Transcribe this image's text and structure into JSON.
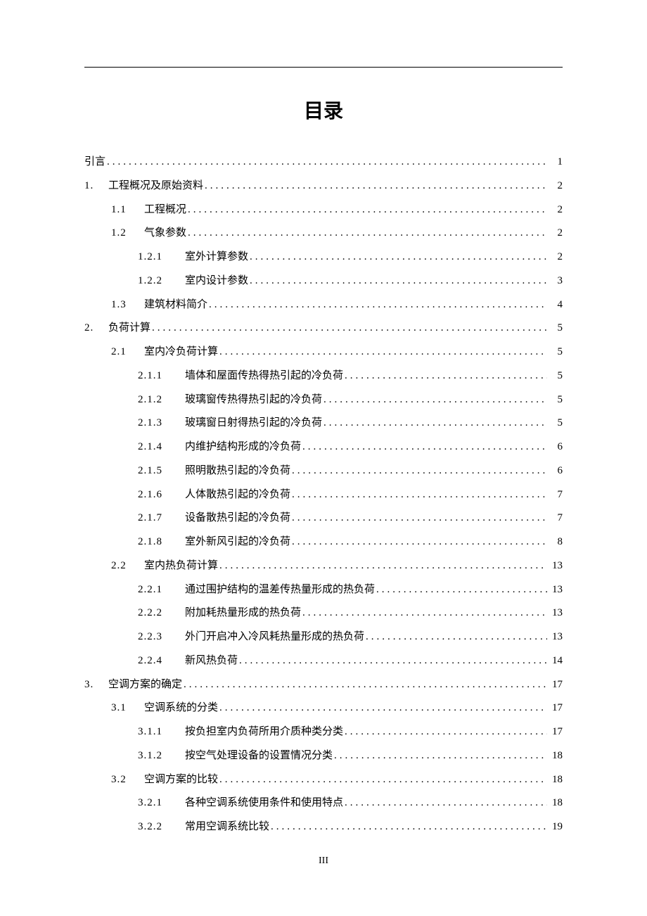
{
  "title": "目录",
  "page_number": "III",
  "toc": [
    {
      "level": 0,
      "num": "",
      "label": "引言",
      "page": "1"
    },
    {
      "level": 0,
      "num": "1.",
      "label": "工程概况及原始资料",
      "page": "2"
    },
    {
      "level": 1,
      "num": "1.1",
      "label": "工程概况",
      "page": "2"
    },
    {
      "level": 1,
      "num": "1.2",
      "label": "气象参数",
      "page": "2"
    },
    {
      "level": 2,
      "num": "1.2.1",
      "label": "室外计算参数",
      "page": "2"
    },
    {
      "level": 2,
      "num": "1.2.2",
      "label": "室内设计参数",
      "page": "3"
    },
    {
      "level": 1,
      "num": "1.3",
      "label": "建筑材料简介",
      "page": "4"
    },
    {
      "level": 0,
      "num": "2.",
      "label": "负荷计算",
      "page": "5"
    },
    {
      "level": 1,
      "num": "2.1",
      "label": "室内冷负荷计算",
      "page": "5"
    },
    {
      "level": 2,
      "num": "2.1.1",
      "label": "墙体和屋面传热得热引起的冷负荷",
      "page": "5"
    },
    {
      "level": 2,
      "num": "2.1.2",
      "label": "玻璃窗传热得热引起的冷负荷",
      "page": "5"
    },
    {
      "level": 2,
      "num": "2.1.3",
      "label": "玻璃窗日射得热引起的冷负荷",
      "page": "5"
    },
    {
      "level": 2,
      "num": "2.1.4",
      "label": "内维护结构形成的冷负荷",
      "page": "6"
    },
    {
      "level": 2,
      "num": "2.1.5",
      "label": "照明散热引起的冷负荷",
      "page": "6"
    },
    {
      "level": 2,
      "num": "2.1.6",
      "label": "人体散热引起的冷负荷",
      "page": "7"
    },
    {
      "level": 2,
      "num": "2.1.7",
      "label": "设备散热引起的冷负荷",
      "page": "7"
    },
    {
      "level": 2,
      "num": "2.1.8",
      "label": "室外新风引起的冷负荷",
      "page": "8"
    },
    {
      "level": 1,
      "num": "2.2",
      "label": "室内热负荷计算",
      "page": "13"
    },
    {
      "level": 2,
      "num": "2.2.1",
      "label": "通过围护结构的温差传热量形成的热负荷",
      "page": "13"
    },
    {
      "level": 2,
      "num": "2.2.2",
      "label": "附加耗热量形成的热负荷",
      "page": "13"
    },
    {
      "level": 2,
      "num": "2.2.3",
      "label": "外门开启冲入冷风耗热量形成的热负荷",
      "page": "13"
    },
    {
      "level": 2,
      "num": "2.2.4",
      "label": "新风热负荷",
      "page": "14"
    },
    {
      "level": 0,
      "num": "3.",
      "label": "空调方案的确定",
      "page": "17"
    },
    {
      "level": 1,
      "num": "3.1",
      "label": "空调系统的分类",
      "page": "17"
    },
    {
      "level": 2,
      "num": "3.1.1",
      "label": "按负担室内负荷所用介质种类分类",
      "page": "17"
    },
    {
      "level": 2,
      "num": "3.1.2",
      "label": "按空气处理设备的设置情况分类",
      "page": "18"
    },
    {
      "level": 1,
      "num": "3.2",
      "label": "空调方案的比较",
      "page": "18"
    },
    {
      "level": 2,
      "num": "3.2.1",
      "label": "各种空调系统使用条件和使用特点",
      "page": "18"
    },
    {
      "level": 2,
      "num": "3.2.2",
      "label": "常用空调系统比较",
      "page": "19"
    }
  ]
}
